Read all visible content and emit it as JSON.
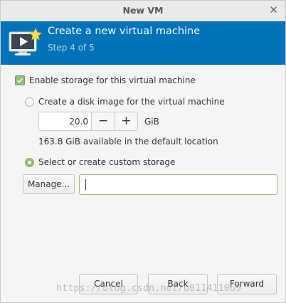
{
  "window": {
    "title": "New VM"
  },
  "header": {
    "title": "Create a new virtual machine",
    "step": "Step 4 of 5"
  },
  "storage": {
    "enable_label": "Enable storage for this virtual machine",
    "enable_checked": true,
    "disk_image_label": "Create a disk image for the virtual machine",
    "disk_size_value": "20.0",
    "minus_label": "−",
    "plus_label": "+",
    "unit": "GiB",
    "available_text": "163.8 GiB available in the default location",
    "custom_label": "Select or create custom storage",
    "manage_label": "Manage...",
    "custom_path": ""
  },
  "footer": {
    "cancel_label": "Cancel",
    "back_label": "Back",
    "forward_label": "Forward"
  },
  "watermark": "https://blog.csdn.net/u011411069"
}
